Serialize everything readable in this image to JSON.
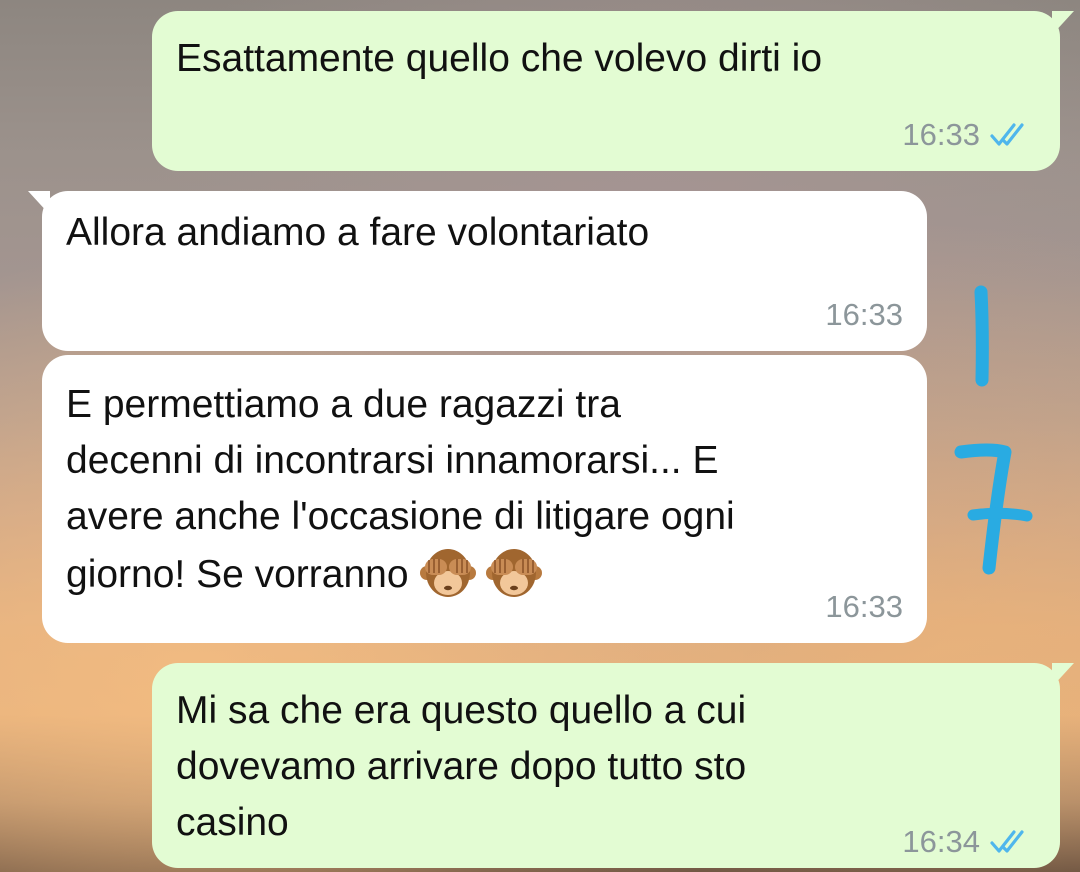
{
  "messages": [
    {
      "direction": "outgoing",
      "text": "Esattamente quello che volevo dirti io",
      "time": "16:33",
      "status": "read"
    },
    {
      "direction": "incoming",
      "text": "Allora andiamo a fare volontariato",
      "time": "16:33"
    },
    {
      "direction": "incoming",
      "text": "E permettiamo a due ragazzi tra\ndecenni di incontrarsi innamorarsi... E\navere anche l'occasione di litigare ogni\ngiorno! Se vorranno",
      "emoji": [
        "see-no-evil-monkey",
        "see-no-evil-monkey"
      ],
      "time": "16:33"
    },
    {
      "direction": "outgoing",
      "text": "Mi sa che era questo quello a cui\ndovevamo arrivare dopo tutto sto\ncasino",
      "time": "16:34",
      "status": "read"
    }
  ],
  "annotation": {
    "text": "17",
    "color": "#29abe2"
  },
  "colors": {
    "outgoing_bubble": "#e3fcd3",
    "incoming_bubble": "#ffffff",
    "read_ticks": "#4fb6ec",
    "timestamp": "#8c969a"
  }
}
